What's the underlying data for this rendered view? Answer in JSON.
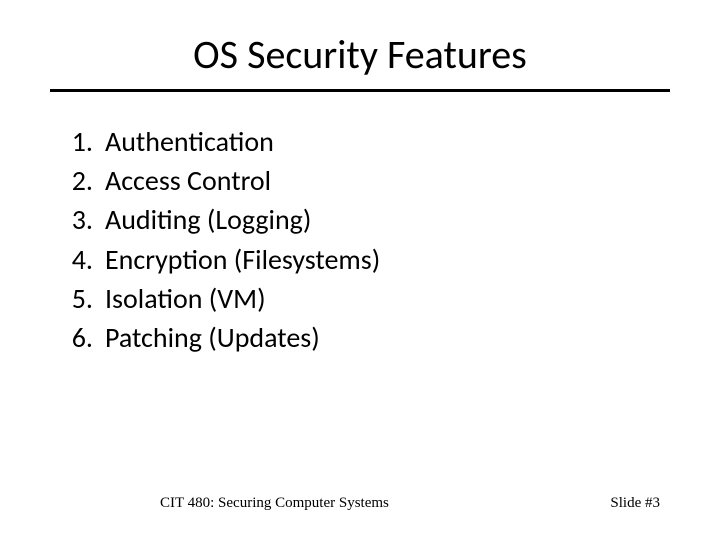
{
  "title": "OS Security Features",
  "items": [
    {
      "number": "1.",
      "text": "Authentication"
    },
    {
      "number": "2.",
      "text": "Access Control"
    },
    {
      "number": "3.",
      "text": "Auditing (Logging)"
    },
    {
      "number": "4.",
      "text": "Encryption (Filesystems)"
    },
    {
      "number": "5.",
      "text": "Isolation (VM)"
    },
    {
      "number": "6.",
      "text": "Patching (Updates)"
    }
  ],
  "footer": {
    "course": "CIT 480: Securing Computer Systems",
    "slide": "Slide #3"
  }
}
